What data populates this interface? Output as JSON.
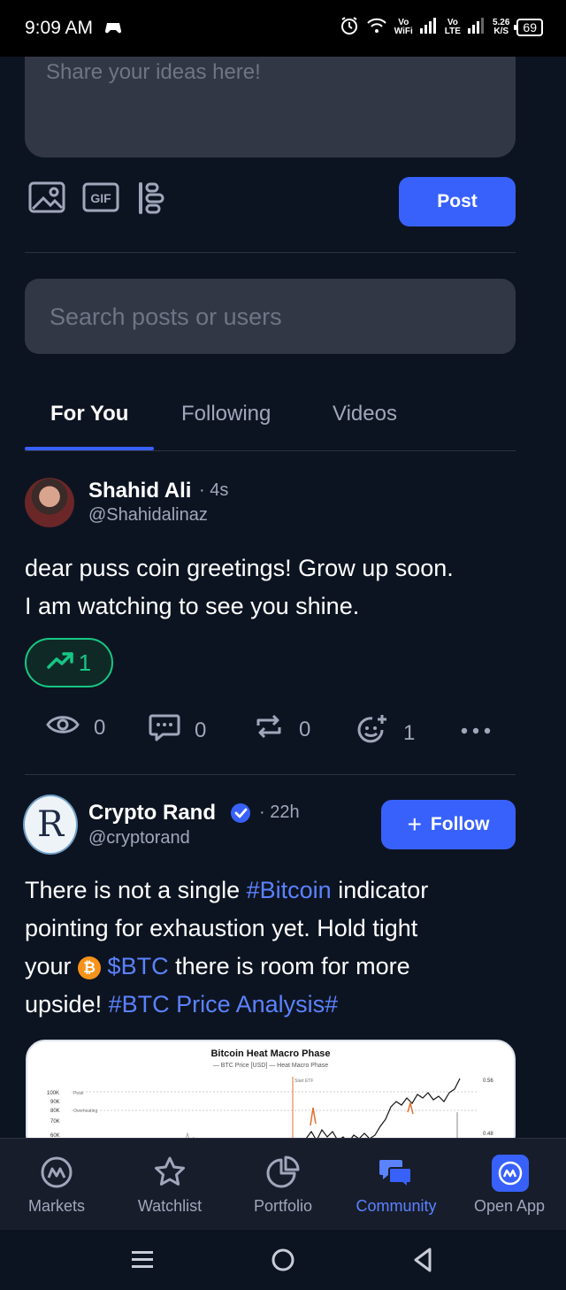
{
  "status_bar": {
    "time": "9:09 AM",
    "wifi_label_top": "Vo",
    "wifi_label_bottom": "WiFi",
    "lte_label_top": "Vo",
    "lte_label_bottom": "LTE",
    "speed_top": "5.26",
    "speed_bottom": "K/S",
    "battery": "69"
  },
  "composer": {
    "placeholder": "Share your ideas here!",
    "post_label": "Post",
    "tools": [
      "image-icon",
      "gif-icon",
      "poll-icon"
    ],
    "gif_label": "GIF"
  },
  "search": {
    "placeholder": "Search posts or users"
  },
  "tabs": [
    {
      "label": "For You",
      "active": true
    },
    {
      "label": "Following",
      "active": false
    },
    {
      "label": "Videos",
      "active": false
    }
  ],
  "posts": [
    {
      "name": "Shahid Ali",
      "time": "· 4s",
      "handle": "@Shahidalinaz",
      "text_line1": "dear puss coin greetings! Grow up soon.",
      "text_line2": "I am watching to see you shine.",
      "trend_count": "1",
      "stats": {
        "views": "0",
        "comments": "0",
        "reposts": "0",
        "reactions": "1"
      }
    },
    {
      "name": "Crypto Rand",
      "time": "· 22h",
      "handle": "@cryptorand",
      "verified": true,
      "follow_label": "Follow",
      "follow_plus": "+",
      "avatar_letter": "R",
      "text_part1": "There is not a single ",
      "tag1": "#Bitcoin",
      "text_part2": " indicator",
      "text_line2": "pointing for exhaustion yet. Hold tight",
      "text_part3": "your ",
      "coin_symbol": "₿",
      "tag2": "$BTC",
      "text_part4": " there is room for more",
      "text_part5": "upside! ",
      "tag3": "#BTC Price Analysis#",
      "image": {
        "title": "Bitcoin Heat Macro Phase",
        "legend": "— BTC Price [USD]   — Heat Macro Phase",
        "y_labels": [
          "100K",
          "90K",
          "80K",
          "70K",
          "60K"
        ],
        "right_labels": [
          "0.56",
          "0.48"
        ],
        "annotations": [
          "Peak",
          "Overheating",
          "Start ETF"
        ]
      }
    }
  ],
  "bottom_nav": [
    {
      "label": "Markets",
      "icon": "markets-icon",
      "active": false
    },
    {
      "label": "Watchlist",
      "icon": "star-icon",
      "active": false
    },
    {
      "label": "Portfolio",
      "icon": "pie-chart-icon",
      "active": false
    },
    {
      "label": "Community",
      "icon": "chat-bubbles-icon",
      "active": true
    },
    {
      "label": "Open App",
      "icon": "app-logo-icon",
      "active": false
    }
  ],
  "colors": {
    "background": "#0d1421",
    "accent": "#3861fb",
    "positive": "#16c784",
    "muted_text": "#a1a7bb",
    "field": "#323746"
  }
}
